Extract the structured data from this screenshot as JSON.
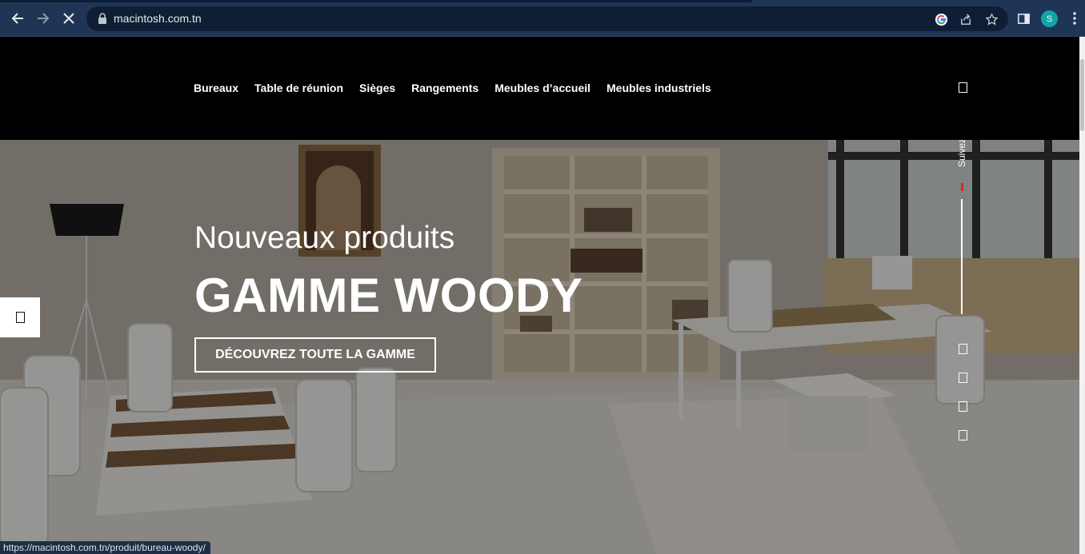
{
  "browser": {
    "url": "macintosh.com.tn",
    "avatar_letter": "S",
    "icons": [
      "back-arrow-icon",
      "forward-arrow-icon",
      "stop-loading-icon",
      "lock-icon",
      "google-icon",
      "share-icon",
      "bookmark-star-icon",
      "side-panel-icon",
      "menu-dots-icon"
    ]
  },
  "header": {
    "nav": [
      "Bureaux",
      "Table de réunion",
      "Sièges",
      "Rangements",
      "Meubles d’accueil",
      "Meubles industriels"
    ]
  },
  "hero": {
    "subtitle": "Nouveaux produits",
    "title": "GAMME WOODY",
    "cta": "DÉCOUVREZ TOUTE LA GAMME",
    "follow_label": "Suivez"
  },
  "status_bar": {
    "link": "https://macintosh.com.tn/produit/bureau-woody/"
  },
  "colors": {
    "chrome": "#1f3556",
    "omnibox": "#0f1e34",
    "header": "#000000",
    "accent_red": "#e32020",
    "avatar": "#12a4a8"
  }
}
